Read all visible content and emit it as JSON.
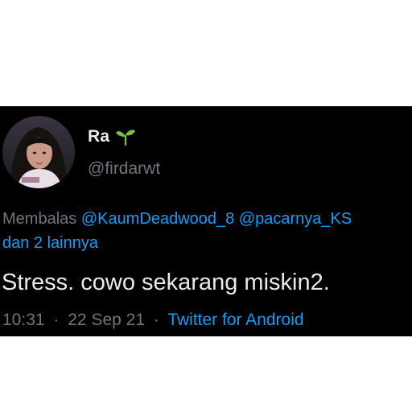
{
  "user": {
    "display_name": "Ra",
    "badge_icon": "sprout-icon",
    "handle": "@firdarwt"
  },
  "reply_context": {
    "prefix": "Membalas",
    "mention_1": "@KaumDeadwood_8",
    "mention_2": "@pacarnya_KS",
    "others": "dan 2 lainnya"
  },
  "tweet": {
    "text": "Stress. cowo sekarang miskin2."
  },
  "meta": {
    "time": "10:31",
    "separator": "·",
    "date": "22 Sep 21",
    "source": "Twitter for Android"
  },
  "colors": {
    "background": "#000000",
    "text_primary": "#e7e9ea",
    "text_secondary": "#71767b",
    "accent": "#1d9bf0",
    "badge_green": "#7cc242"
  }
}
